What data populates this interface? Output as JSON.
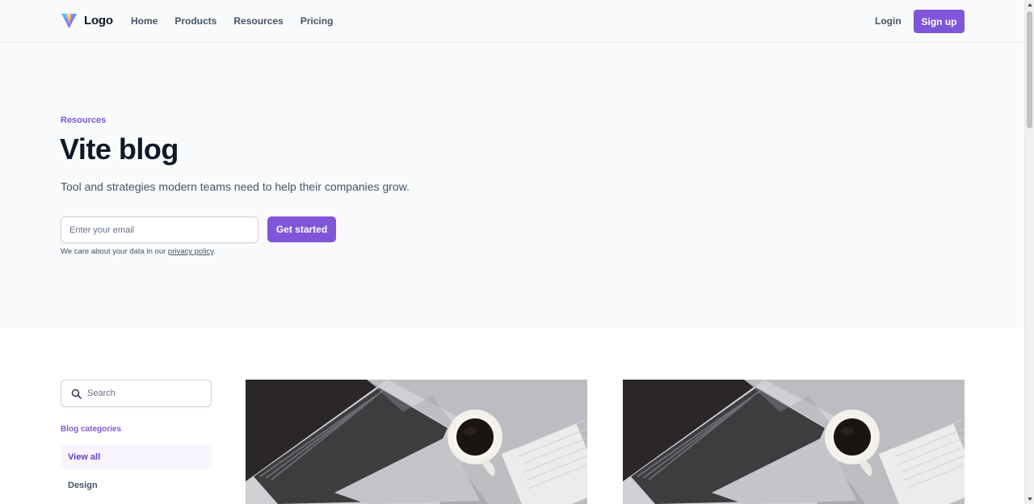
{
  "header": {
    "logo_text": "Logo",
    "nav": [
      "Home",
      "Products",
      "Resources",
      "Pricing"
    ],
    "login_label": "Login",
    "signup_label": "Sign up"
  },
  "hero": {
    "eyebrow": "Resources",
    "title": "Vite blog",
    "subtitle": "Tool and strategies modern teams need to help their companies grow.",
    "email_placeholder": "Enter your email",
    "cta_label": "Get started",
    "privacy_prefix": "We care about your data in our ",
    "privacy_link": "privacy policy",
    "privacy_suffix": "."
  },
  "sidebar": {
    "search_placeholder": "Search",
    "categories_label": "Blog categories",
    "categories": [
      "View all",
      "Design"
    ]
  },
  "colors": {
    "accent": "#7f56d9",
    "hero_bg": "#f9fafb",
    "text_primary": "#101828",
    "text_secondary": "#475467"
  },
  "icons": {
    "logo": "vite-logo-icon",
    "search": "search-icon"
  }
}
